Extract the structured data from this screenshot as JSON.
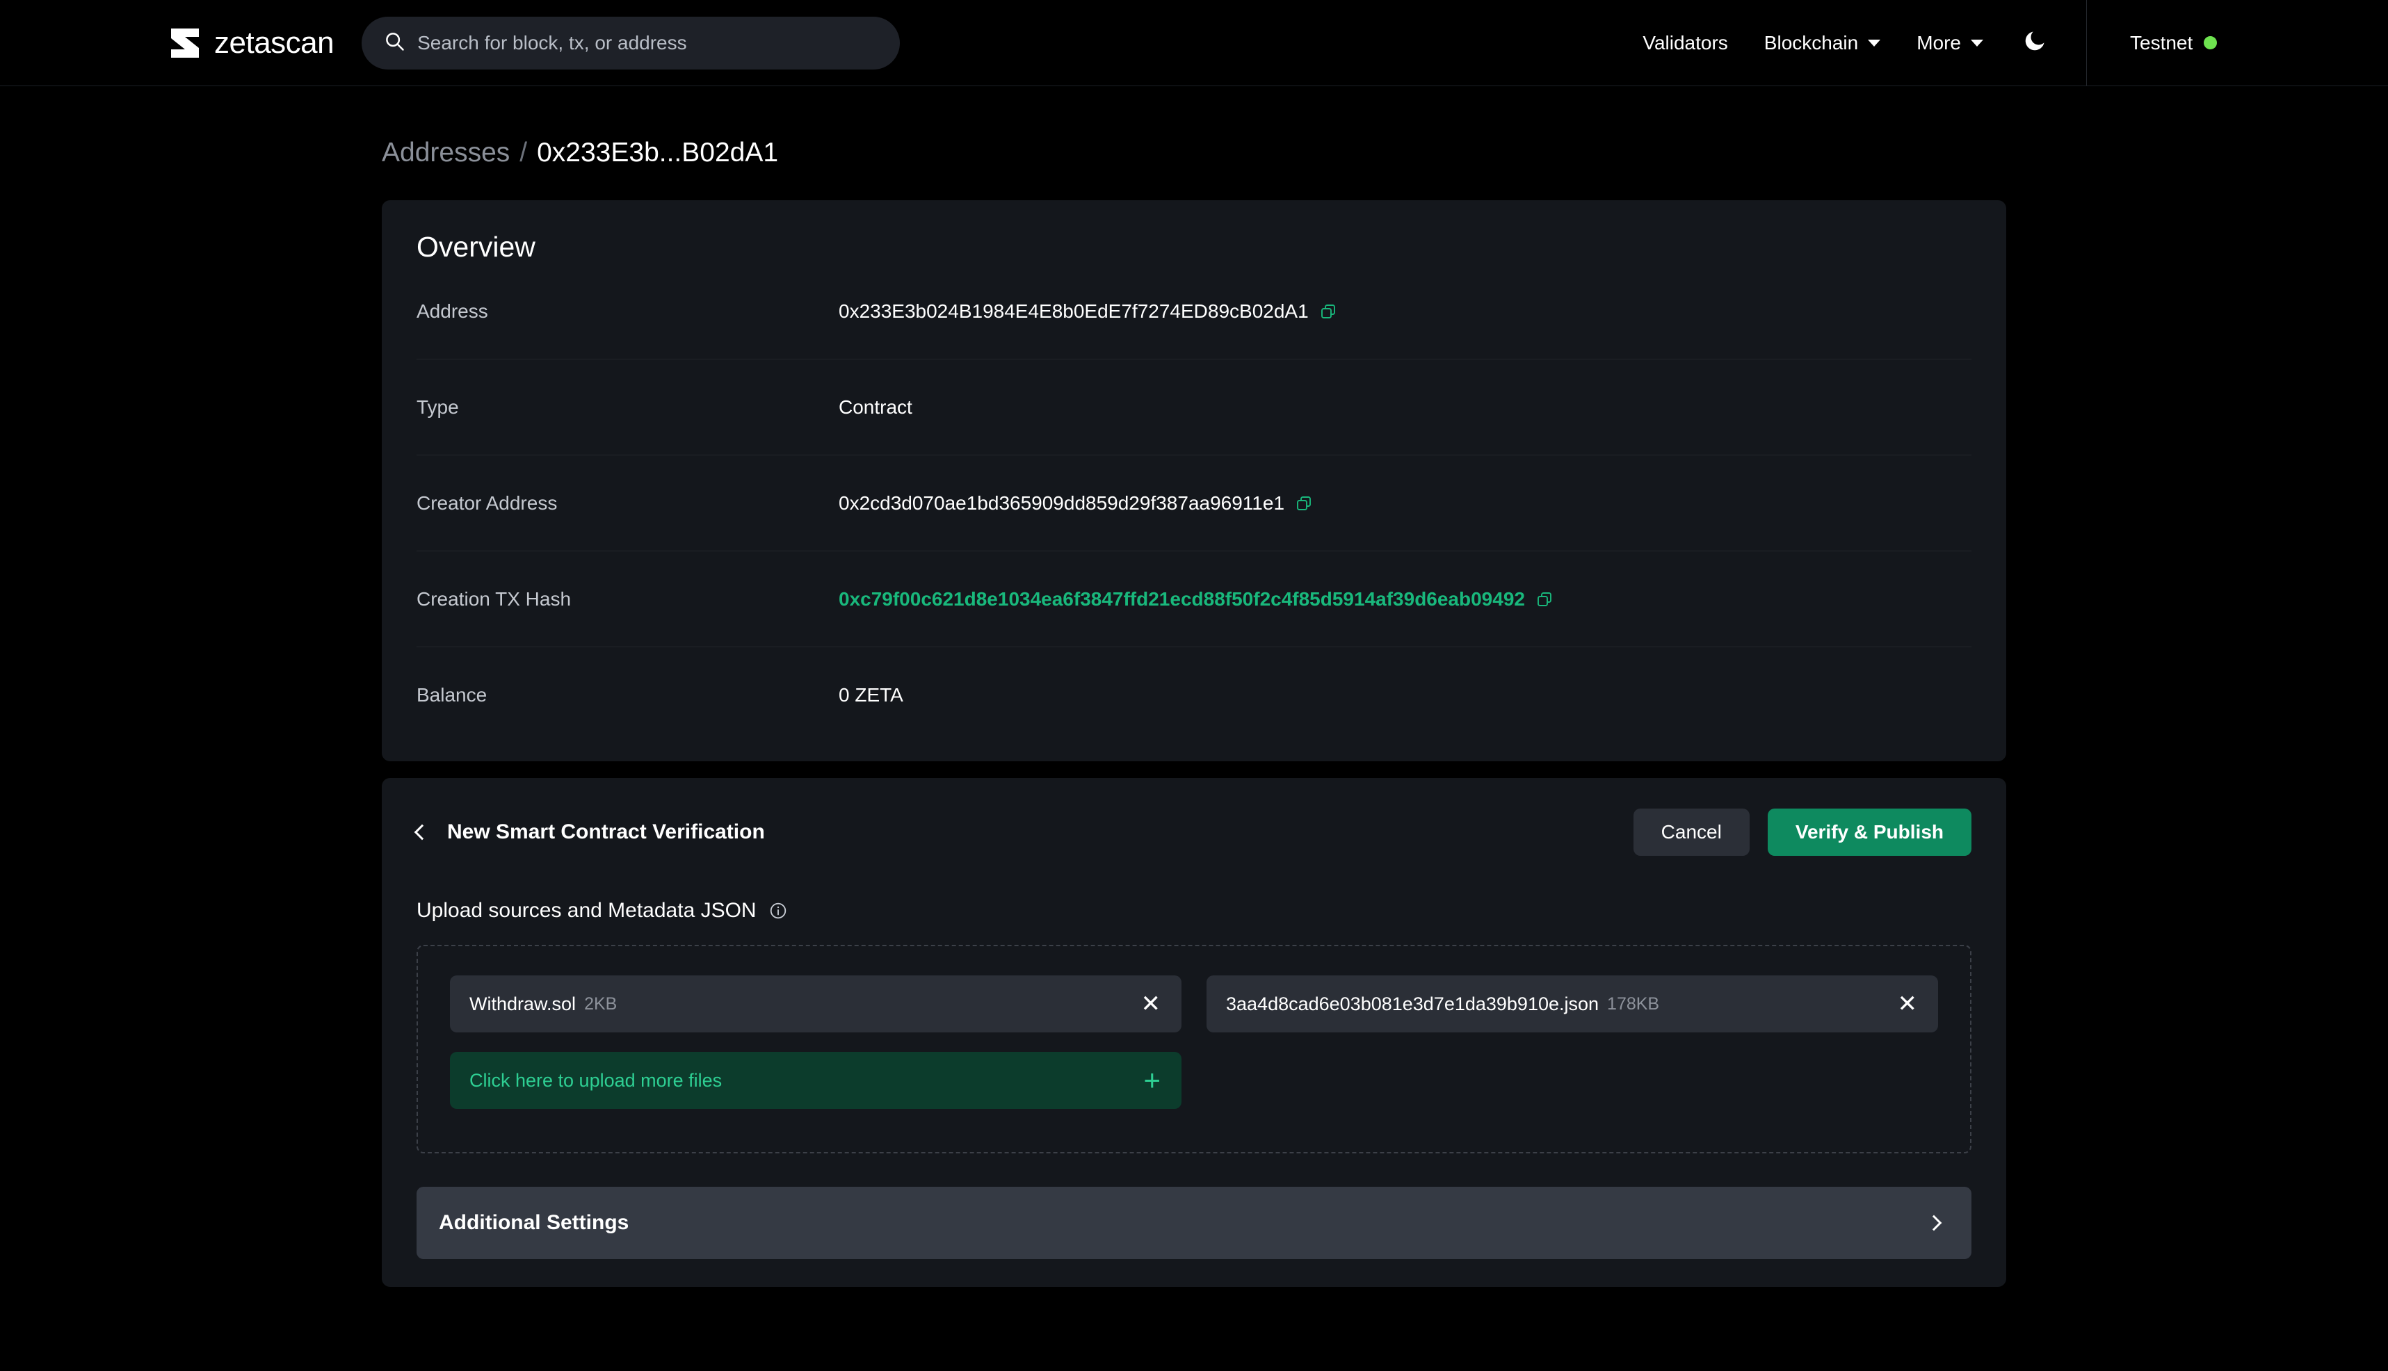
{
  "header": {
    "brand": "zetascan",
    "logo_icon": "zetascan-z-logo",
    "search": {
      "placeholder": "Search for block, tx, or address",
      "value": "",
      "icon": "search-icon"
    },
    "nav": [
      {
        "label": "Validators",
        "has_chevron": false
      },
      {
        "label": "Blockchain",
        "has_chevron": true
      },
      {
        "label": "More",
        "has_chevron": true
      }
    ],
    "theme_toggle_icon": "moon-icon",
    "network": {
      "label": "Testnet",
      "status_color": "#6ee34f"
    }
  },
  "breadcrumb": {
    "parent": "Addresses",
    "separator": "/",
    "current": "0x233E3b...B02dA1"
  },
  "overview": {
    "title": "Overview",
    "rows": [
      {
        "label": "Address",
        "value": "0x233E3b024B1984E4E8b0EdE7f7274ED89cB02dA1",
        "copyable": true,
        "is_link": false
      },
      {
        "label": "Type",
        "value": "Contract",
        "copyable": false,
        "is_link": false
      },
      {
        "label": "Creator Address",
        "value": "0x2cd3d070ae1bd365909dd859d29f387aa96911e1",
        "copyable": true,
        "is_link": false
      },
      {
        "label": "Creation TX Hash",
        "value": "0xc79f00c621d8e1034ea6f3847ffd21ecd88f50f2c4f85d5914af39d6eab09492",
        "copyable": true,
        "is_link": true
      },
      {
        "label": "Balance",
        "value": "0 ZETA",
        "copyable": false,
        "is_link": false
      }
    ]
  },
  "verification": {
    "back_icon": "chevron-left-icon",
    "title": "New Smart Contract Verification",
    "cancel_label": "Cancel",
    "submit_label": "Verify & Publish",
    "upload_label": "Upload sources and Metadata JSON",
    "info_icon": "info-icon",
    "files": [
      {
        "name": "Withdraw.sol",
        "size": "2KB"
      },
      {
        "name": "3aa4d8cad6e03b081e3d7e1da39b910e.json",
        "size": "178KB"
      }
    ],
    "upload_more_label": "Click here to upload more files",
    "upload_more_icon": "plus-icon",
    "additional_settings_label": "Additional Settings",
    "additional_settings_icon": "chevron-right-icon"
  },
  "colors": {
    "accent_green": "#19b87c",
    "primary_button": "#0e8a5f",
    "page_background": "#000000",
    "card_background": "#14171c",
    "status_green": "#6ee34f"
  }
}
